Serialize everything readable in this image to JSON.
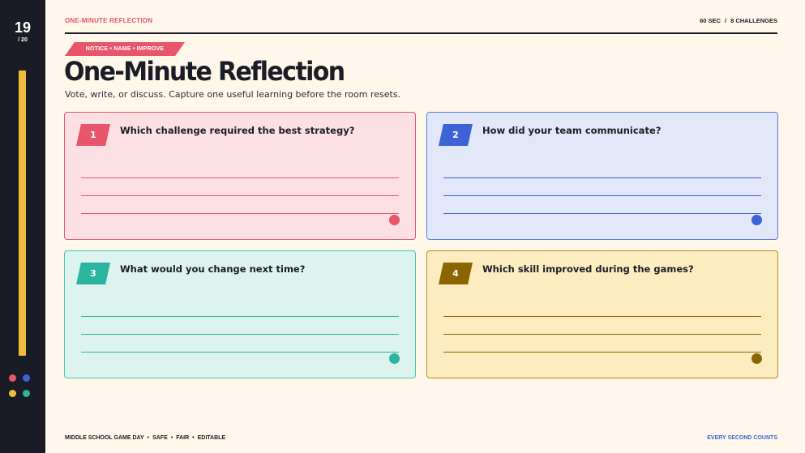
{
  "sidebar": {
    "slide_number": "19",
    "slide_total": "/ 20",
    "dot_colors": [
      "#e8566b",
      "#3d63d6",
      "#f2bd3d",
      "#2bb5a0"
    ]
  },
  "header": {
    "label": "ONE-MINUTE REFLECTION",
    "meta_time": "60 SEC",
    "meta_sep": "/",
    "meta_count": "8 CHALLENGES"
  },
  "hero": {
    "eyebrow": "NOTICE • NAME • IMPROVE",
    "title": "One-Minute Reflection",
    "subtitle": "Vote, write, or discuss. Capture one useful learning before the room resets."
  },
  "cards": [
    {
      "number": "1",
      "question": "Which challenge required the best strategy?",
      "accent": "#e8566b",
      "bg": "#fde0e4",
      "border": "#e8566b"
    },
    {
      "number": "2",
      "question": "How did your team communicate?",
      "accent": "#3d63d6",
      "bg": "#e2e7fa",
      "border": "#5b7fe0"
    },
    {
      "number": "3",
      "question": "What would you change next time?",
      "accent": "#2bb5a0",
      "bg": "#dcf3ee",
      "border": "#4fc2ae"
    },
    {
      "number": "4",
      "question": "Which skill improved during the games?",
      "accent": "#8a6500",
      "bg": "#fcecc0",
      "border": "#b58d22"
    }
  ],
  "footer": {
    "items": [
      "MIDDLE SCHOOL GAME DAY",
      "SAFE",
      "FAIR",
      "EDITABLE"
    ],
    "bullet": "•",
    "tagline": "EVERY SECOND COUNTS"
  }
}
